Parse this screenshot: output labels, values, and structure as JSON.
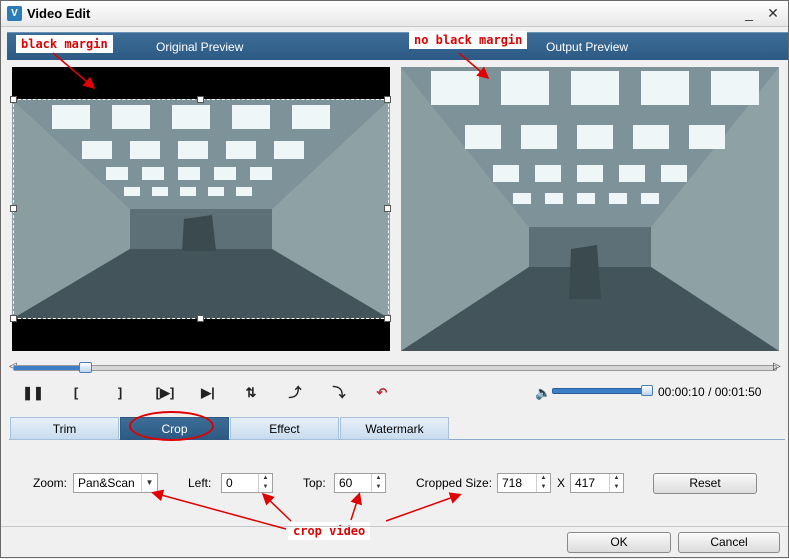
{
  "window": {
    "title": "Video Edit",
    "app_icon": "V",
    "minimize_glyph": "_",
    "close_glyph": "✕"
  },
  "preview": {
    "original_label": "Original Preview",
    "output_label": "Output Preview"
  },
  "annotations": {
    "black_margin": "black margin",
    "no_black_margin": "no black margin",
    "crop_video": "crop video"
  },
  "seek": {
    "progress_fraction": 0.09
  },
  "controls": {
    "buttons": [
      {
        "name": "pause-button",
        "glyph": "❚❚"
      },
      {
        "name": "mark-in-button",
        "glyph": "["
      },
      {
        "name": "mark-out-button",
        "glyph": "]"
      },
      {
        "name": "preview-clip-button",
        "glyph": "[▶]"
      },
      {
        "name": "next-frame-button",
        "glyph": "▶|"
      },
      {
        "name": "flip-vertical-button",
        "glyph": "⇅"
      },
      {
        "name": "rotate-right-button",
        "glyph": "⤴"
      },
      {
        "name": "rotate-left-button",
        "glyph": "⤵"
      },
      {
        "name": "undo-button",
        "glyph": "↶"
      }
    ],
    "volume_icon": "speaker-icon",
    "volume_fraction": 0.9,
    "time_current": "00:00:10",
    "time_separator": "/",
    "time_total": "00:01:50"
  },
  "tabs": [
    {
      "label": "Trim",
      "active": false
    },
    {
      "label": "Crop",
      "active": true
    },
    {
      "label": "Effect",
      "active": false
    },
    {
      "label": "Watermark",
      "active": false
    }
  ],
  "crop": {
    "zoom_label": "Zoom:",
    "zoom_value": "Pan&Scan",
    "left_label": "Left:",
    "left_value": "0",
    "top_label": "Top:",
    "top_value": "60",
    "size_label": "Cropped Size:",
    "width_value": "718",
    "size_separator": "X",
    "height_value": "417",
    "reset_label": "Reset"
  },
  "footer": {
    "ok_label": "OK",
    "cancel_label": "Cancel"
  },
  "colors": {
    "accent": "#2c5a84",
    "annotation": "#e00000"
  }
}
